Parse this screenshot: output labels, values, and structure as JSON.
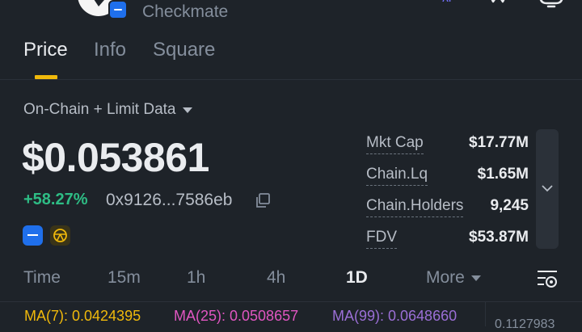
{
  "header": {
    "token_name": "Checkmate",
    "icons": [
      "back-icon",
      "token-logo",
      "verified-badge",
      "ai-icon",
      "star-icon",
      "notification-icon"
    ]
  },
  "tabs": [
    {
      "label": "Price",
      "active": true
    },
    {
      "label": "Info",
      "active": false
    },
    {
      "label": "Square",
      "active": false
    }
  ],
  "overview": {
    "data_source": "On-Chain + Limit Data",
    "price": "$0.053861",
    "change": "+58.27%",
    "address": "0x9126...7586eb"
  },
  "stats": [
    {
      "label": "Mkt Cap",
      "value": "$17.77M"
    },
    {
      "label": "Chain.Lq",
      "value": "$1.65M"
    },
    {
      "label": "Chain.Holders",
      "value": "9,245"
    },
    {
      "label": "FDV",
      "value": "$53.87M"
    }
  ],
  "timeframes": [
    {
      "label": "Time",
      "active": false
    },
    {
      "label": "15m",
      "active": false
    },
    {
      "label": "1h",
      "active": false
    },
    {
      "label": "4h",
      "active": false
    },
    {
      "label": "1D",
      "active": true
    },
    {
      "label": "More",
      "active": false
    }
  ],
  "moving_averages": [
    {
      "label": "MA(7): 0.0424395",
      "color": "#f0b90b"
    },
    {
      "label": "MA(25): 0.0508657",
      "color": "#e056c1"
    },
    {
      "label": "MA(99): 0.0648660",
      "color": "#9b6fd6"
    }
  ],
  "scale_value": "0.1127983",
  "colors": {
    "accent": "#f0b90b",
    "positive": "#2ebd85",
    "background": "#1e2329"
  }
}
